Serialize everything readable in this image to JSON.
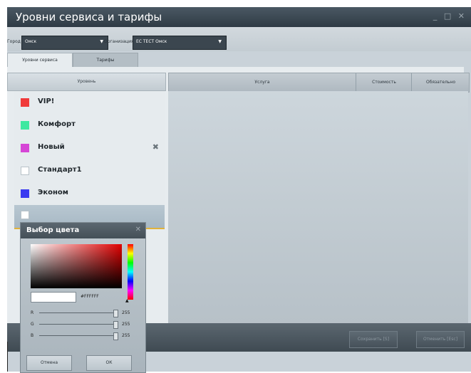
{
  "window": {
    "title": "Уровни сервиса и тарифы",
    "controls": "_ □ ✕"
  },
  "filters": {
    "city_label": "Город",
    "city_value": "Омск",
    "org_label": "Организация",
    "org_value": "ЕС ТЕСТ Омск",
    "dropdown_arrow": "▼"
  },
  "tabs": [
    {
      "label": "Уровни сервиса"
    },
    {
      "label": "Тарифы"
    }
  ],
  "levels": {
    "header": "Уровень",
    "items": [
      {
        "name": "VIP!",
        "color": "#f03a3a"
      },
      {
        "name": "Комфорт",
        "color": "#3ee8a0"
      },
      {
        "name": "Новый",
        "color": "#d646d6"
      },
      {
        "name": "Стандарт1",
        "color": "#ffffff"
      },
      {
        "name": "Эконом",
        "color": "#3a3af0"
      },
      {
        "name": "",
        "color": "#ffffff"
      }
    ],
    "delete_glyph": "✖"
  },
  "grid": {
    "columns": [
      "Услуга",
      "Стоимость",
      "Обязательно"
    ]
  },
  "footer": {
    "save_label": "Сохранить [S]",
    "cancel_label": "Отменить [Esc]"
  },
  "color_picker": {
    "title": "Выбор цвета",
    "close_glyph": "✕",
    "hex_value": "#FFFFFF",
    "hue_marker": "▲",
    "channels": [
      {
        "label": "R",
        "value": "255"
      },
      {
        "label": "G",
        "value": "255"
      },
      {
        "label": "B",
        "value": "255"
      }
    ],
    "cancel_label": "Отмена",
    "ok_label": "ОК"
  },
  "colors": {
    "accent_selected_border": "#e0b23b",
    "titlebar": "#2f3b45"
  }
}
